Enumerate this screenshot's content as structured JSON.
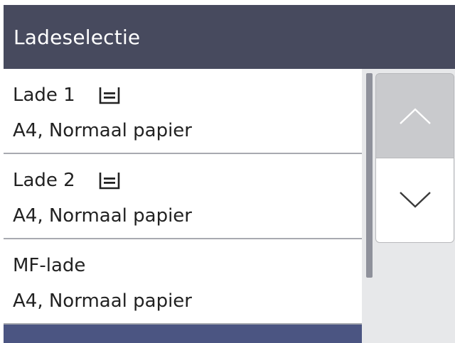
{
  "header": {
    "title": "Ladeselectie"
  },
  "trays": [
    {
      "name": "Lade 1",
      "detail": "A4, Normaal papier",
      "icon": "paper-tray-icon"
    },
    {
      "name": "Lade 2",
      "detail": "A4, Normaal papier",
      "icon": "paper-tray-icon"
    },
    {
      "name": "MF-lade",
      "detail": "A4, Normaal papier"
    }
  ],
  "scroll": {
    "up_icon": "chevron-up-icon",
    "down_icon": "chevron-down-icon"
  },
  "colors": {
    "header_bg": "#474a5e",
    "selected_bg": "#4b5582",
    "scroll_bg": "#e7e8ea",
    "up_button_bg": "#c9cacd"
  }
}
